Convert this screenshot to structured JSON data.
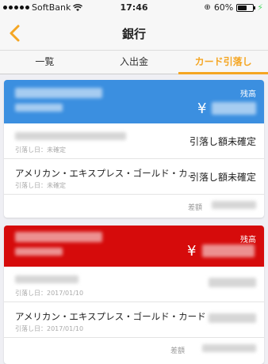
{
  "status_bar": {
    "carrier": "SoftBank",
    "time": "17:46",
    "battery": "60%",
    "battery_level": 0.6
  },
  "nav": {
    "title": "銀行"
  },
  "tabs": [
    {
      "label": "一覧",
      "active": false
    },
    {
      "label": "入出金",
      "active": false
    },
    {
      "label": "カード引落し",
      "active": true
    }
  ],
  "accounts": [
    {
      "header_color": "#3b8fe0",
      "balance_label": "残高",
      "yen_symbol": "¥",
      "rows": [
        {
          "name": "",
          "date_label": "引落し日：未確定",
          "status": "引落し額未確定"
        },
        {
          "name": "アメリカン・エキスプレス・ゴールド・カ…",
          "date_label": "引落し日：未確定",
          "status": "引落し額未確定"
        }
      ],
      "diff_label": "差額"
    },
    {
      "header_color": "#d60b0b",
      "balance_label": "残高",
      "yen_symbol": "¥",
      "rows": [
        {
          "name": "",
          "date_label": "引落し日：2017/01/10",
          "status": ""
        },
        {
          "name": "アメリカン・エキスプレス・ゴールド・カード",
          "date_label": "引落し日：2017/01/10",
          "status": ""
        }
      ],
      "diff_label": "差額"
    }
  ],
  "colors": {
    "accent": "#f5a623"
  }
}
